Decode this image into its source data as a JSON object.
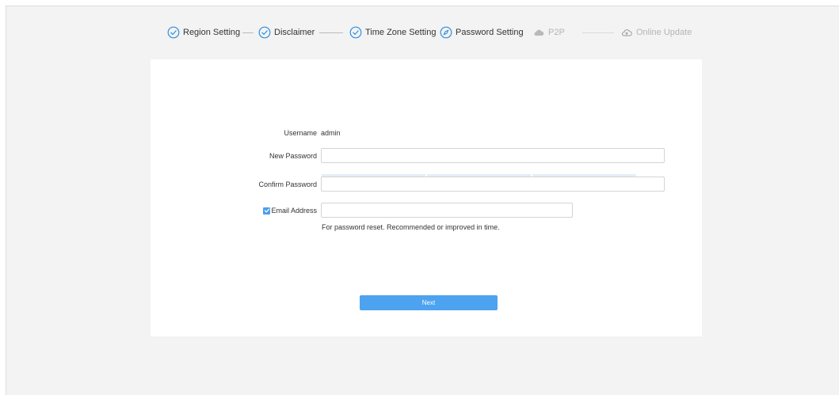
{
  "wizard": {
    "steps": [
      {
        "label": "Region Setting",
        "state": "done",
        "icon": "check-circle-icon"
      },
      {
        "label": "Disclaimer",
        "state": "done",
        "icon": "check-circle-icon"
      },
      {
        "label": "Time Zone Setting",
        "state": "done",
        "icon": "check-circle-icon"
      },
      {
        "label": "Password Setting",
        "state": "active",
        "icon": "compass-circle-icon"
      },
      {
        "label": "P2P",
        "state": "todo",
        "icon": "cloud-icon"
      },
      {
        "label": "Online Update",
        "state": "todo",
        "icon": "cloud-upload-icon"
      }
    ]
  },
  "form": {
    "username_label": "Username",
    "username_value": "admin",
    "new_password_label": "New Password",
    "new_password_value": "",
    "confirm_password_label": "Confirm Password",
    "confirm_password_value": "",
    "email_label": "Email Address",
    "email_checked": true,
    "email_value": "",
    "email_hint": "For password reset. Recommended or improved in time."
  },
  "actions": {
    "next_label": "Next"
  },
  "colors": {
    "accent": "#4da3ef",
    "done_icon": "#2f8fe0",
    "todo": "#b4b4b4",
    "background": "#f3f3f3"
  }
}
